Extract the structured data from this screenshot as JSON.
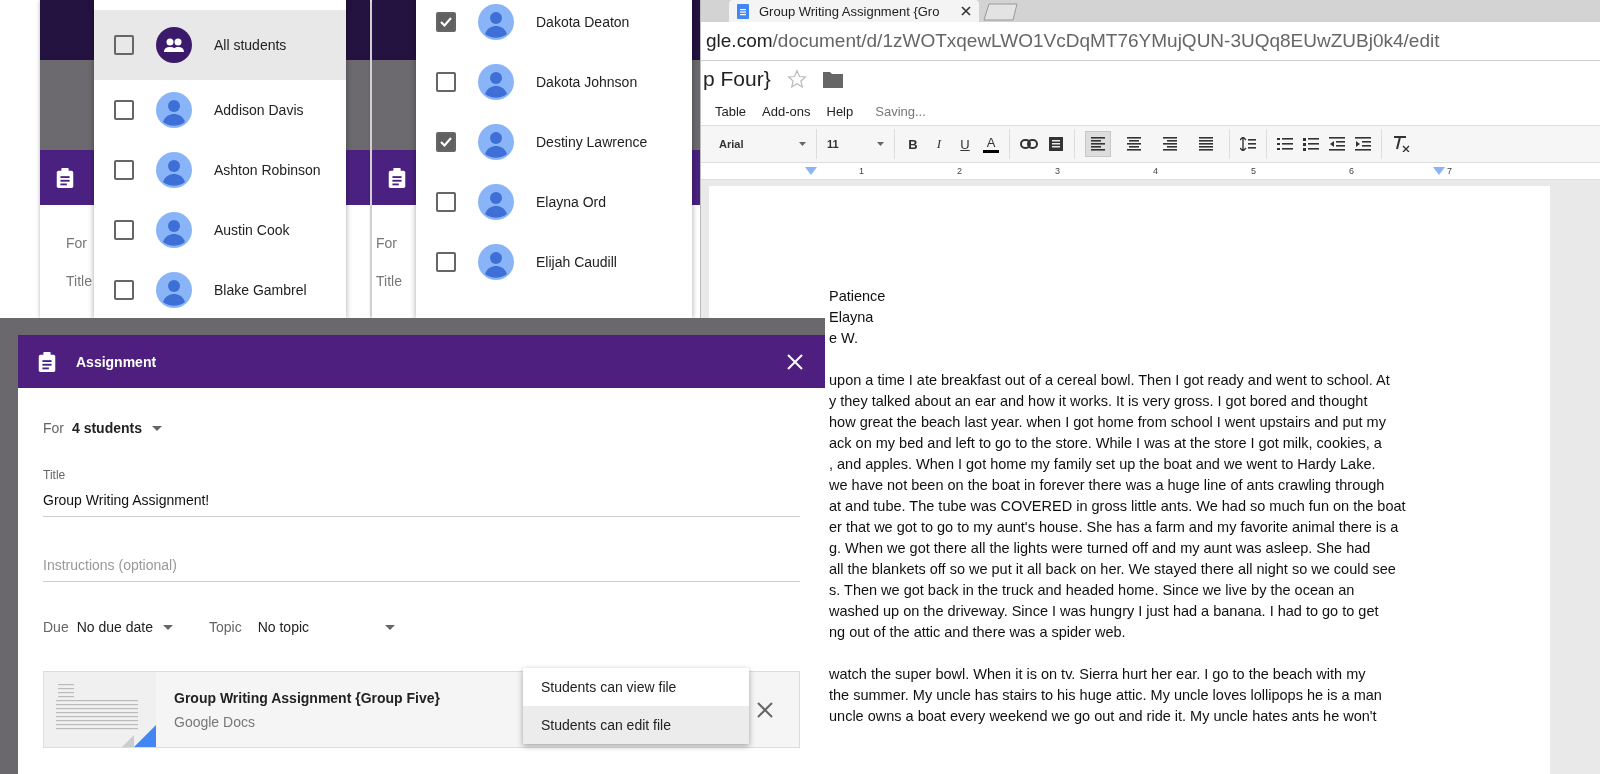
{
  "back_windows": [
    {
      "labels": [
        "For",
        "Title"
      ]
    },
    {
      "labels": [
        "For",
        "Title"
      ]
    }
  ],
  "student_pickers": [
    {
      "students": [
        {
          "name": "All students",
          "kind": "group",
          "checked": false,
          "selected": true
        },
        {
          "name": "Addison Davis",
          "kind": "person",
          "checked": false,
          "selected": false
        },
        {
          "name": "Ashton Robinson",
          "kind": "person",
          "checked": false,
          "selected": false
        },
        {
          "name": "Austin Cook",
          "kind": "person",
          "checked": false,
          "selected": false
        },
        {
          "name": "Blake Gambrel",
          "kind": "person",
          "checked": false,
          "selected": false
        }
      ]
    },
    {
      "students": [
        {
          "name": "Dakota Deaton",
          "kind": "person",
          "checked": true,
          "selected": false
        },
        {
          "name": "Dakota Johnson",
          "kind": "person",
          "checked": false,
          "selected": false
        },
        {
          "name": "Destiny Lawrence",
          "kind": "person",
          "checked": true,
          "selected": false
        },
        {
          "name": "Elayna Ord",
          "kind": "person",
          "checked": false,
          "selected": false
        },
        {
          "name": "Elijah Caudill",
          "kind": "person",
          "checked": false,
          "selected": false
        }
      ]
    }
  ],
  "docs_window": {
    "tab": {
      "title": "Group Writing Assignment {Gro"
    },
    "address": {
      "host": "gle.com",
      "path": "/document/d/1zWOTxqewLWO1VcDqMT76YMujQUN-3UQq8EUwZUBj0k4/edit"
    },
    "doc_title": "p Four}",
    "menu": [
      "Table",
      "Add-ons",
      "Help"
    ],
    "save_status": "Saving...",
    "toolbar": {
      "font": "Arial",
      "size": "11",
      "format_buttons": [
        "B",
        "I",
        "U",
        "A"
      ],
      "alignment": [
        {
          "selected": true
        },
        {
          "selected": false
        },
        {
          "selected": false
        },
        {
          "selected": false
        }
      ]
    },
    "ruler": [
      "1",
      "2",
      "3",
      "4",
      "5",
      "6",
      "7"
    ],
    "names": [
      "Patience",
      "Elayna",
      "e W."
    ],
    "paragraphs": [
      [
        "upon a time I ate breakfast out of a cereal bowl. Then I got ready and went to school. At",
        "y they talked about an ear and how it works. It is very gross. I got bored and thought",
        "how great the beach last year. when I got home from school I went upstairs and put my",
        "ack on my bed and left to go to the store. While I was at the store I got milk, cookies, a",
        ", and apples. When I got home my family set up the boat and we went to Hardy Lake.",
        "we have not been on the boat in forever there was a huge line of ants crawling through",
        "at and tube. The tube was COVERED in gross little ants. We had so much fun on the boat",
        "er that we got to go to my aunt's house. She has a farm and my favorite animal there is a",
        "g. When we got there all the lights were turned off and my aunt was asleep. She had",
        "all the blankets off so we put it all back on her. We stayed there all night so we could see",
        "s. Then we got back in the truck and headed home. Since we live by the ocean an",
        "washed up on the driveway. Since I was hungry I just had a banana. I had to go to get",
        "ng out of the attic and there was a spider web."
      ],
      [
        "watch the super bowl. When it is on tv. Sierra hurt her ear. I go to the beach with my",
        "the summer. My uncle has stairs to his huge attic. My uncle loves lollipops he is a man",
        "uncle owns a boat every weekend we go out and ride it. My uncle hates ants he won't"
      ]
    ]
  },
  "assignment_dialog": {
    "title": "Assignment",
    "for": {
      "label": "For",
      "value": "4 students"
    },
    "title_field": {
      "label": "Title",
      "value": "Group Writing Assignment!"
    },
    "instructions": {
      "placeholder": "Instructions (optional)"
    },
    "due": {
      "label": "Due",
      "value": "No due date"
    },
    "topic": {
      "label": "Topic",
      "value": "No topic"
    },
    "attachment": {
      "name": "Group Writing Assignment {Group Five}",
      "type": "Google Docs"
    },
    "share_menu": [
      {
        "label": "Students can view file",
        "selected": false
      },
      {
        "label": "Students can edit file",
        "selected": true
      }
    ]
  }
}
